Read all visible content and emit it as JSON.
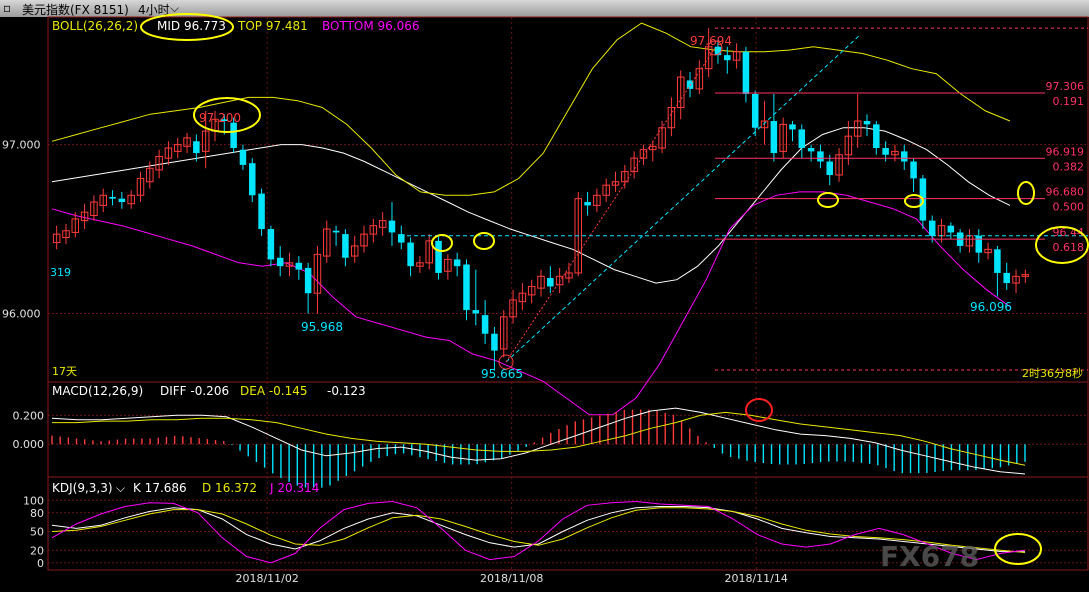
{
  "header": {
    "instrument": "美元指数(FX 8151)",
    "period": "4小时",
    "period_caret": "⌵"
  },
  "boll": {
    "label": "BOLL(26,26,2)",
    "mid_label": "MID 96.773",
    "top_label": "TOP 97.481",
    "bottom_label": "BOTTOM 96.066"
  },
  "macd": {
    "label": "MACD(12,26,9)",
    "diff_label": "DIFF -0.206",
    "dea_label": "DEA -0.145",
    "hist_label": "-0.123"
  },
  "kdj": {
    "label": "KDJ(9,3,3)",
    "caret": "⌵",
    "k_label": "K 17.686",
    "d_label": "D 16.372",
    "j_label": "J 20.314"
  },
  "left_info": {
    "days": "17天",
    "clipped_value": "319"
  },
  "countdown": "2时36分8秒",
  "watermark": "FX678",
  "colors": {
    "up": "#ff3b3b",
    "down": "#00e5ff",
    "boll_mid": "#ffffff",
    "boll_top": "#e8e800",
    "boll_bottom": "#ff00ff",
    "fib": "#ff3366",
    "mid_text": "#ffffff",
    "top_text": "#e8e800",
    "bottom_text": "#ff00ff",
    "highlight_circle": "#ffff00",
    "macd_circle": "#ff2020"
  },
  "chart_data": [
    {
      "type": "candlestick",
      "title": "BOLL(26,26,2)",
      "y_ticks": [
        "97.000",
        "96.000"
      ],
      "y_range": [
        95.6,
        97.75
      ],
      "x_ticks": [
        "2018/11/02",
        "2018/11/08",
        "2018/11/14"
      ],
      "annotations": [
        "97.200",
        "97.694",
        "95.968",
        "95.665",
        "96.096"
      ],
      "fib_levels": [
        {
          "price": "97.306",
          "ratio": "0.191"
        },
        {
          "price": "96.919",
          "ratio": "0.382"
        },
        {
          "price": "96.680",
          "ratio": "0.500"
        },
        {
          "price": "96.44",
          "ratio": "0.618"
        }
      ],
      "candles": [
        [
          96.42,
          96.47,
          96.38,
          96.52
        ],
        [
          96.45,
          96.49,
          96.41,
          96.53
        ],
        [
          96.48,
          96.56,
          96.45,
          96.6
        ],
        [
          96.55,
          96.6,
          96.5,
          96.65
        ],
        [
          96.58,
          96.66,
          96.55,
          96.7
        ],
        [
          96.64,
          96.7,
          96.6,
          96.74
        ],
        [
          96.69,
          96.68,
          96.64,
          96.73
        ],
        [
          96.68,
          96.66,
          96.62,
          96.72
        ],
        [
          96.65,
          96.7,
          96.62,
          96.73
        ],
        [
          96.7,
          96.8,
          96.66,
          96.84
        ],
        [
          96.78,
          96.86,
          96.74,
          96.9
        ],
        [
          96.85,
          96.93,
          96.8,
          96.97
        ],
        [
          96.92,
          96.98,
          96.88,
          97.02
        ],
        [
          96.96,
          97.0,
          96.92,
          97.04
        ],
        [
          96.99,
          97.04,
          96.95,
          97.07
        ],
        [
          97.02,
          96.95,
          96.9,
          97.06
        ],
        [
          96.96,
          97.08,
          96.86,
          97.2
        ],
        [
          97.08,
          97.15,
          97.02,
          97.2
        ],
        [
          97.15,
          97.14,
          97.06,
          97.18
        ],
        [
          97.13,
          96.98,
          96.95,
          97.16
        ],
        [
          96.97,
          96.88,
          96.85,
          97.0
        ],
        [
          96.89,
          96.7,
          96.66,
          96.92
        ],
        [
          96.71,
          96.5,
          96.46,
          96.74
        ],
        [
          96.5,
          96.32,
          96.28,
          96.52
        ],
        [
          96.33,
          96.28,
          96.22,
          96.4
        ],
        [
          96.28,
          96.3,
          96.22,
          96.36
        ],
        [
          96.3,
          96.26,
          96.2,
          96.34
        ],
        [
          96.27,
          96.12,
          96.0,
          96.3
        ],
        [
          96.12,
          96.35,
          96.0,
          96.4
        ],
        [
          96.34,
          96.5,
          96.3,
          96.55
        ],
        [
          96.49,
          96.48,
          96.4,
          96.52
        ],
        [
          96.47,
          96.33,
          96.28,
          96.5
        ],
        [
          96.34,
          96.4,
          96.3,
          96.46
        ],
        [
          96.4,
          96.47,
          96.36,
          96.52
        ],
        [
          96.47,
          96.52,
          96.42,
          96.56
        ],
        [
          96.51,
          96.55,
          96.46,
          96.6
        ],
        [
          96.55,
          96.48,
          96.4,
          96.66
        ],
        [
          96.47,
          96.42,
          96.38,
          96.52
        ],
        [
          96.42,
          96.28,
          96.22,
          96.45
        ],
        [
          96.28,
          96.3,
          96.24,
          96.34
        ],
        [
          96.3,
          96.43,
          96.26,
          96.47
        ],
        [
          96.43,
          96.24,
          96.2,
          96.46
        ],
        [
          96.25,
          96.32,
          96.2,
          96.35
        ],
        [
          96.32,
          96.28,
          96.22,
          96.36
        ],
        [
          96.29,
          96.02,
          95.96,
          96.32
        ],
        [
          96.02,
          96.0,
          95.93,
          96.26
        ],
        [
          95.99,
          95.88,
          95.82,
          96.08
        ],
        [
          95.88,
          95.78,
          95.66,
          95.92
        ],
        [
          95.79,
          95.98,
          95.74,
          96.02
        ],
        [
          95.98,
          96.08,
          95.94,
          96.14
        ],
        [
          96.07,
          96.12,
          96.02,
          96.18
        ],
        [
          96.11,
          96.16,
          96.06,
          96.2
        ],
        [
          96.15,
          96.22,
          96.1,
          96.26
        ],
        [
          96.21,
          96.16,
          96.12,
          96.28
        ],
        [
          96.17,
          96.22,
          96.12,
          96.27
        ],
        [
          96.21,
          96.24,
          96.18,
          96.3
        ],
        [
          96.24,
          96.68,
          96.22,
          96.72
        ],
        [
          96.66,
          96.64,
          96.58,
          96.72
        ],
        [
          96.64,
          96.7,
          96.6,
          96.74
        ],
        [
          96.7,
          96.76,
          96.66,
          96.8
        ],
        [
          96.76,
          96.78,
          96.72,
          96.84
        ],
        [
          96.78,
          96.84,
          96.74,
          96.88
        ],
        [
          96.84,
          96.92,
          96.8,
          96.96
        ],
        [
          96.92,
          96.97,
          96.88,
          97.0
        ],
        [
          96.97,
          96.99,
          96.9,
          97.02
        ],
        [
          96.98,
          97.1,
          96.95,
          97.14
        ],
        [
          97.1,
          97.22,
          97.05,
          97.28
        ],
        [
          97.22,
          97.4,
          97.15,
          97.44
        ],
        [
          97.38,
          97.33,
          97.28,
          97.43
        ],
        [
          97.33,
          97.45,
          97.3,
          97.5
        ],
        [
          97.45,
          97.58,
          97.4,
          97.69
        ],
        [
          97.58,
          97.53,
          97.48,
          97.62
        ],
        [
          97.53,
          97.5,
          97.42,
          97.58
        ],
        [
          97.5,
          97.55,
          97.45,
          97.6
        ],
        [
          97.55,
          97.3,
          97.25,
          97.58
        ],
        [
          97.3,
          97.1,
          97.05,
          97.32
        ],
        [
          97.1,
          97.14,
          97.0,
          97.26
        ],
        [
          97.14,
          96.95,
          96.9,
          97.3
        ],
        [
          96.96,
          97.12,
          96.92,
          97.16
        ],
        [
          97.12,
          97.09,
          97.02,
          97.14
        ],
        [
          97.09,
          96.98,
          96.92,
          97.12
        ],
        [
          96.98,
          96.96,
          96.9,
          97.0
        ],
        [
          96.96,
          96.9,
          96.86,
          97.0
        ],
        [
          96.9,
          96.82,
          96.76,
          96.94
        ],
        [
          96.82,
          96.94,
          96.78,
          96.98
        ],
        [
          96.94,
          97.05,
          96.88,
          97.14
        ],
        [
          97.05,
          97.14,
          96.98,
          97.3
        ],
        [
          97.14,
          97.12,
          97.05,
          97.18
        ],
        [
          97.12,
          96.98,
          96.94,
          97.14
        ],
        [
          96.98,
          96.94,
          96.9,
          97.02
        ],
        [
          96.94,
          96.96,
          96.9,
          97.0
        ],
        [
          96.96,
          96.9,
          96.85,
          97.0
        ],
        [
          96.9,
          96.8,
          96.72,
          96.92
        ],
        [
          96.8,
          96.55,
          96.5,
          96.82
        ],
        [
          96.55,
          96.46,
          96.42,
          96.58
        ],
        [
          96.46,
          96.52,
          96.42,
          96.56
        ],
        [
          96.52,
          96.48,
          96.44,
          96.54
        ],
        [
          96.48,
          96.4,
          96.36,
          96.5
        ],
        [
          96.4,
          96.46,
          96.36,
          96.5
        ],
        [
          96.46,
          96.36,
          96.3,
          96.5
        ],
        [
          96.36,
          96.38,
          96.32,
          96.42
        ],
        [
          96.38,
          96.24,
          96.1,
          96.4
        ],
        [
          96.24,
          96.18,
          96.14,
          96.3
        ],
        [
          96.18,
          96.22,
          96.12,
          96.26
        ],
        [
          96.22,
          96.23,
          96.18,
          96.26
        ]
      ],
      "series": [
        {
          "name": "MID",
          "values": [
            96.78,
            96.8,
            96.82,
            96.84,
            96.86,
            96.88,
            96.9,
            96.92,
            96.94,
            96.96,
            96.98,
            97.0,
            97.0,
            96.98,
            96.95,
            96.9,
            96.84,
            96.78,
            96.72,
            96.66,
            96.6,
            96.55,
            96.5,
            96.46,
            96.42,
            96.38,
            96.32,
            96.26,
            96.22,
            96.18,
            96.2,
            96.28,
            96.4,
            96.55,
            96.7,
            96.85,
            96.98,
            97.06,
            97.1,
            97.1,
            97.08,
            97.03,
            96.97,
            96.88,
            96.78,
            96.7,
            96.64
          ]
        },
        {
          "name": "TOP",
          "values": [
            97.02,
            97.06,
            97.1,
            97.14,
            97.18,
            97.2,
            97.22,
            97.25,
            97.28,
            97.28,
            97.26,
            97.22,
            97.12,
            96.98,
            96.82,
            96.72,
            96.7,
            96.7,
            96.72,
            96.8,
            96.95,
            97.2,
            97.45,
            97.62,
            97.72,
            97.66,
            97.58,
            97.56,
            97.55,
            97.55,
            97.56,
            97.58,
            97.56,
            97.54,
            97.5,
            97.45,
            97.42,
            97.3,
            97.2,
            97.14
          ]
        },
        {
          "name": "BOTTOM",
          "values": [
            96.62,
            96.58,
            96.55,
            96.52,
            96.48,
            96.44,
            96.4,
            96.35,
            96.3,
            96.28,
            96.3,
            96.24,
            96.1,
            95.98,
            95.94,
            95.9,
            95.86,
            95.84,
            95.76,
            95.72,
            95.66,
            95.6,
            95.5,
            95.4,
            95.4,
            95.5,
            95.7,
            95.95,
            96.2,
            96.5,
            96.64,
            96.7,
            96.72,
            96.72,
            96.7,
            96.66,
            96.62,
            96.56,
            96.4,
            96.26,
            96.14,
            96.04
          ]
        }
      ]
    },
    {
      "type": "bar",
      "title": "MACD(12,26,9)",
      "y_ticks": [
        "0.200",
        "0.000"
      ],
      "y_range": [
        -0.22,
        0.32
      ],
      "series": [
        {
          "name": "DIFF",
          "values": [
            0.18,
            0.17,
            0.17,
            0.18,
            0.19,
            0.2,
            0.2,
            0.19,
            0.12,
            0.04,
            -0.04,
            -0.08,
            -0.06,
            -0.03,
            -0.02,
            -0.05,
            -0.09,
            -0.11,
            -0.1,
            -0.06,
            0.0,
            0.06,
            0.12,
            0.18,
            0.23,
            0.25,
            0.22,
            0.18,
            0.14,
            0.1,
            0.07,
            0.06,
            0.04,
            0.01,
            -0.04,
            -0.08,
            -0.12,
            -0.16,
            -0.19,
            -0.206
          ]
        },
        {
          "name": "DEA",
          "values": [
            0.15,
            0.15,
            0.16,
            0.16,
            0.17,
            0.17,
            0.18,
            0.18,
            0.17,
            0.15,
            0.11,
            0.07,
            0.04,
            0.02,
            0.01,
            0.0,
            -0.02,
            -0.04,
            -0.05,
            -0.05,
            -0.04,
            -0.02,
            0.02,
            0.06,
            0.11,
            0.15,
            0.2,
            0.22,
            0.2,
            0.17,
            0.14,
            0.12,
            0.1,
            0.08,
            0.06,
            0.02,
            -0.03,
            -0.07,
            -0.11,
            -0.145
          ]
        }
      ]
    },
    {
      "type": "line",
      "title": "KDJ(9,3,3)",
      "y_ticks": [
        "100",
        "80",
        "50",
        "20",
        "0"
      ],
      "y_range": [
        -10,
        110
      ],
      "series": [
        {
          "name": "K",
          "values": [
            60,
            55,
            60,
            72,
            82,
            88,
            85,
            70,
            45,
            30,
            22,
            35,
            55,
            70,
            80,
            75,
            60,
            45,
            32,
            25,
            30,
            50,
            68,
            80,
            88,
            90,
            90,
            88,
            82,
            70,
            55,
            48,
            42,
            40,
            38,
            34,
            30,
            26,
            22,
            18,
            17.7
          ]
        },
        {
          "name": "D",
          "values": [
            50,
            52,
            58,
            68,
            78,
            85,
            85,
            78,
            62,
            44,
            30,
            28,
            38,
            56,
            72,
            76,
            70,
            58,
            45,
            34,
            28,
            38,
            56,
            72,
            84,
            88,
            88,
            86,
            82,
            74,
            62,
            52,
            46,
            42,
            40,
            37,
            33,
            28,
            24,
            20,
            16.4
          ]
        },
        {
          "name": "J",
          "values": [
            40,
            62,
            78,
            90,
            96,
            95,
            80,
            40,
            10,
            0,
            15,
            55,
            85,
            95,
            98,
            88,
            55,
            20,
            5,
            10,
            35,
            70,
            92,
            96,
            98,
            94,
            92,
            90,
            70,
            45,
            30,
            25,
            30,
            45,
            55,
            45,
            30,
            15,
            5,
            15,
            20.3
          ]
        }
      ]
    }
  ]
}
